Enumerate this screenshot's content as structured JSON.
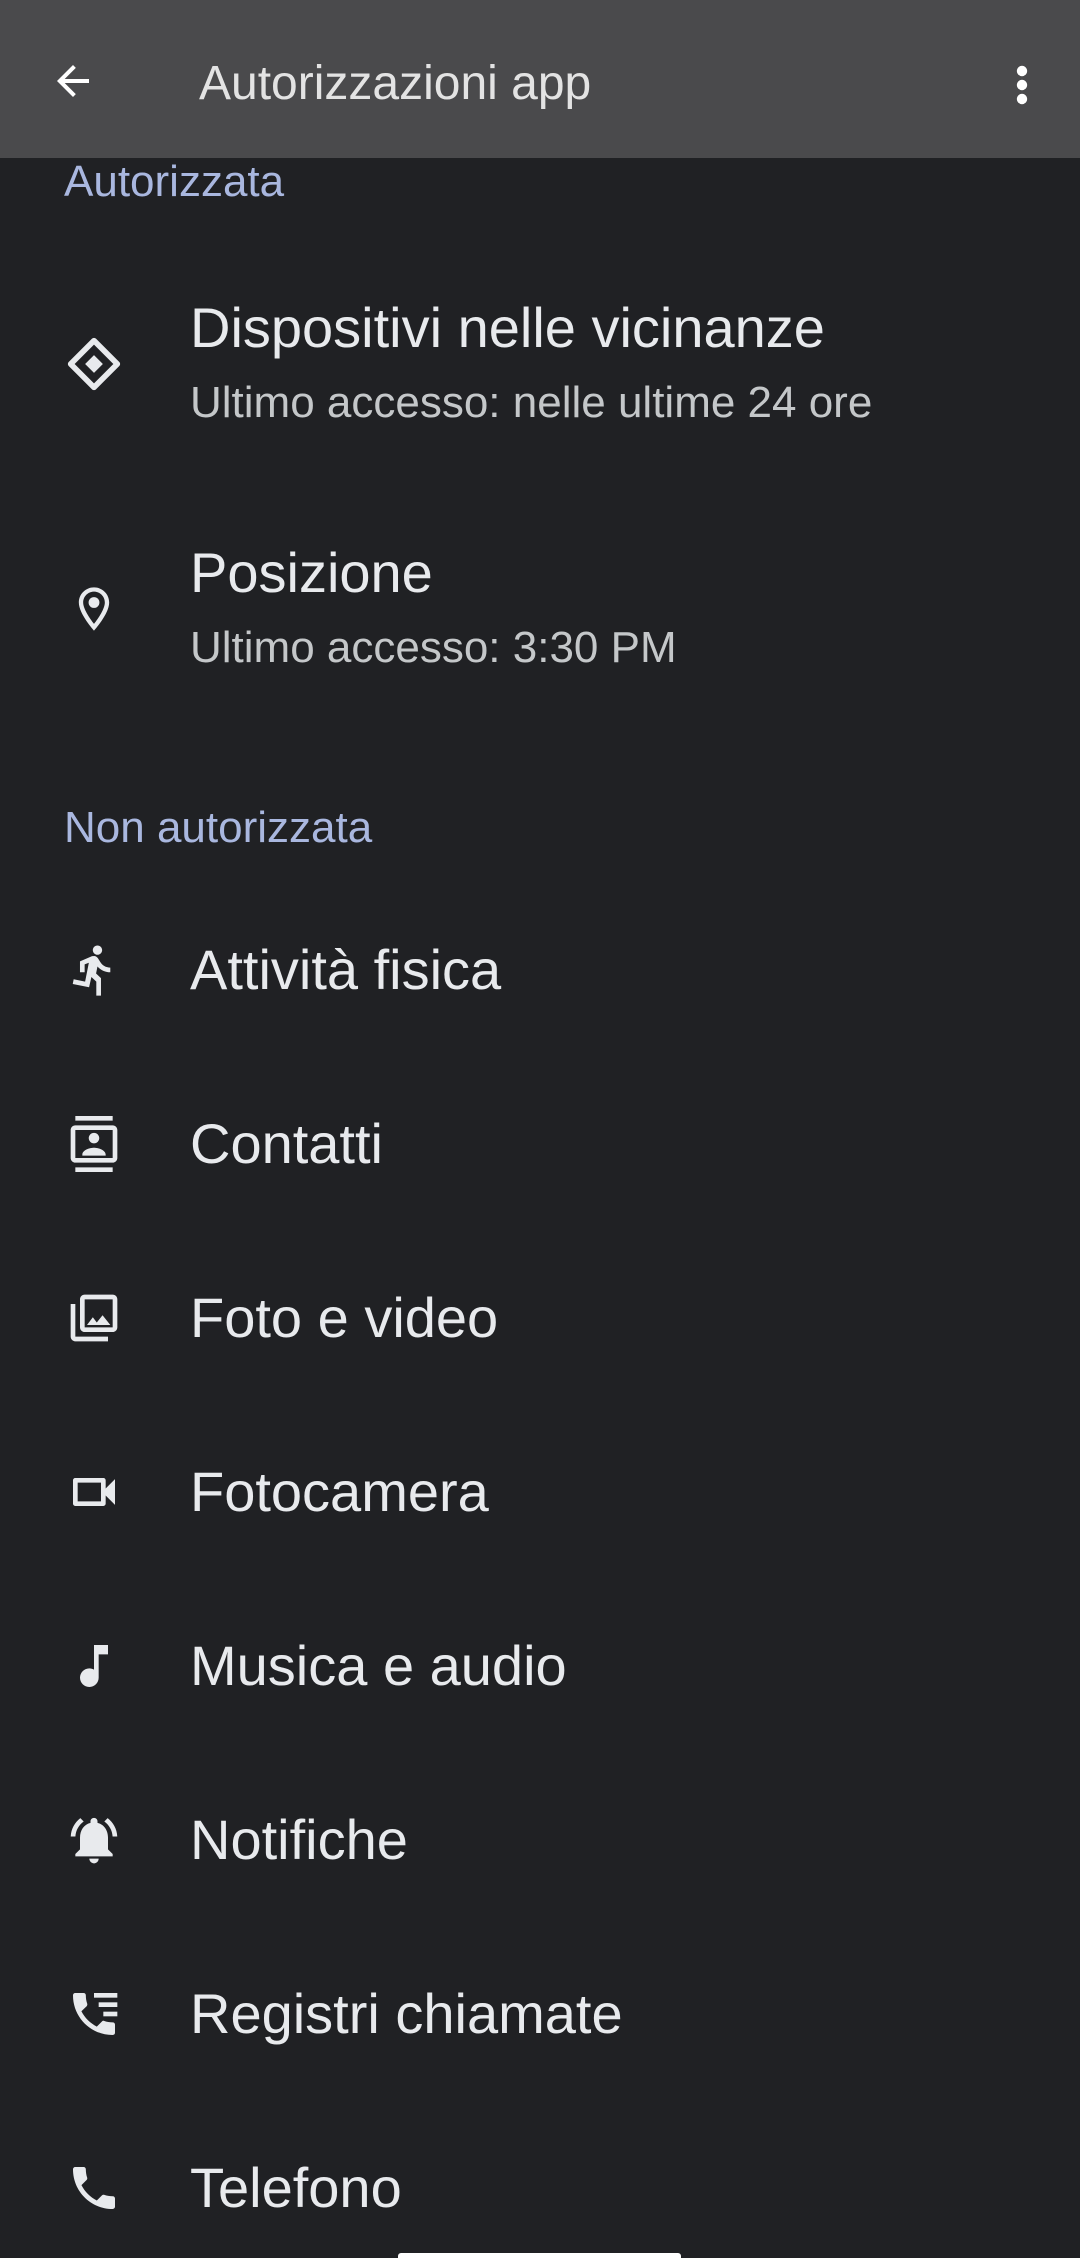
{
  "appbar": {
    "title": "Autorizzazioni app"
  },
  "sections": {
    "allowed": {
      "header": "Autorizzata",
      "items": [
        {
          "icon": "nearby-devices-icon",
          "label": "Dispositivi nelle vicinanze",
          "sub": "Ultimo accesso: nelle ultime 24 ore"
        },
        {
          "icon": "location-pin-icon",
          "label": "Posizione",
          "sub": "Ultimo accesso: 3:30 PM"
        }
      ]
    },
    "denied": {
      "header": "Non autorizzata",
      "items": [
        {
          "icon": "physical-activity-icon",
          "label": "Attività fisica"
        },
        {
          "icon": "contacts-icon",
          "label": "Contatti"
        },
        {
          "icon": "photos-videos-icon",
          "label": "Foto e video"
        },
        {
          "icon": "camera-icon",
          "label": "Fotocamera"
        },
        {
          "icon": "music-note-icon",
          "label": "Musica e audio"
        },
        {
          "icon": "notification-bell-icon",
          "label": "Notifiche"
        },
        {
          "icon": "call-log-icon",
          "label": "Registri chiamate"
        },
        {
          "icon": "phone-icon",
          "label": "Telefono"
        }
      ]
    }
  },
  "colors": {
    "background": "#202124",
    "appbar": "#4a4a4c",
    "section_header": "#a9b7df",
    "primary_text": "#e8eaed",
    "secondary_text": "#c4c7c9"
  }
}
